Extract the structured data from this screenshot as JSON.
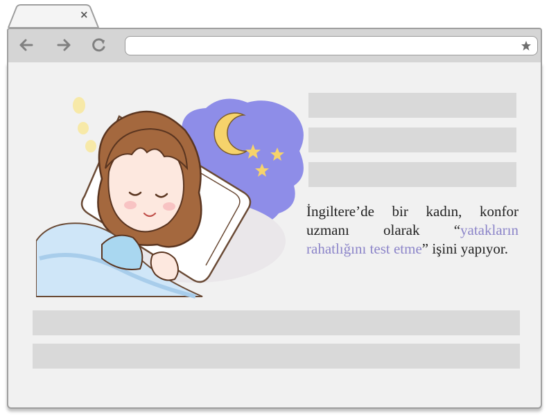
{
  "browser": {
    "tab_close_glyph": "×",
    "icons": [
      "back-icon",
      "forward-icon",
      "reload-icon",
      "bookmark-star-icon",
      "close-icon"
    ]
  },
  "article": {
    "line1": "İngiltere’de bir kadın, konfor uzmanı olarak “",
    "highlight": "yatakların rahatlığını test etme",
    "line2": "” işini yapıyor."
  },
  "colors": {
    "highlight": "#8c85c9",
    "night_cloud": "#8e8de8",
    "moon": "#f6d36b",
    "placeholder": "#d9d9d9"
  }
}
